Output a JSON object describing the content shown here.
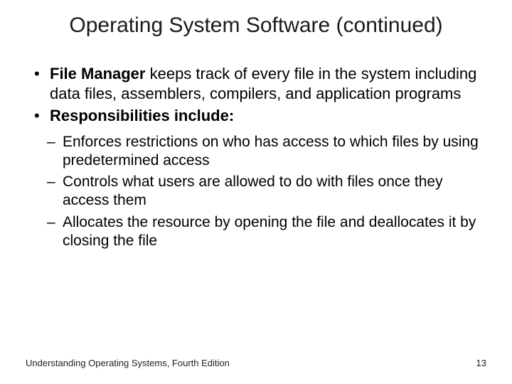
{
  "title": "Operating System Software (continued)",
  "bullets": [
    {
      "bold": "File Manager",
      "rest": " keeps track of every file in the system including data files, assemblers, compilers, and application programs"
    },
    {
      "bold": "Responsibilities include:",
      "rest": ""
    }
  ],
  "subbullets": [
    "Enforces restrictions on who has access to which files by using predetermined access",
    "Controls what users are allowed to do with files once they access them",
    "Allocates the resource by opening the file and deallocates it by closing the file"
  ],
  "footer": {
    "left": "Understanding Operating Systems, Fourth Edition",
    "right": "13"
  }
}
